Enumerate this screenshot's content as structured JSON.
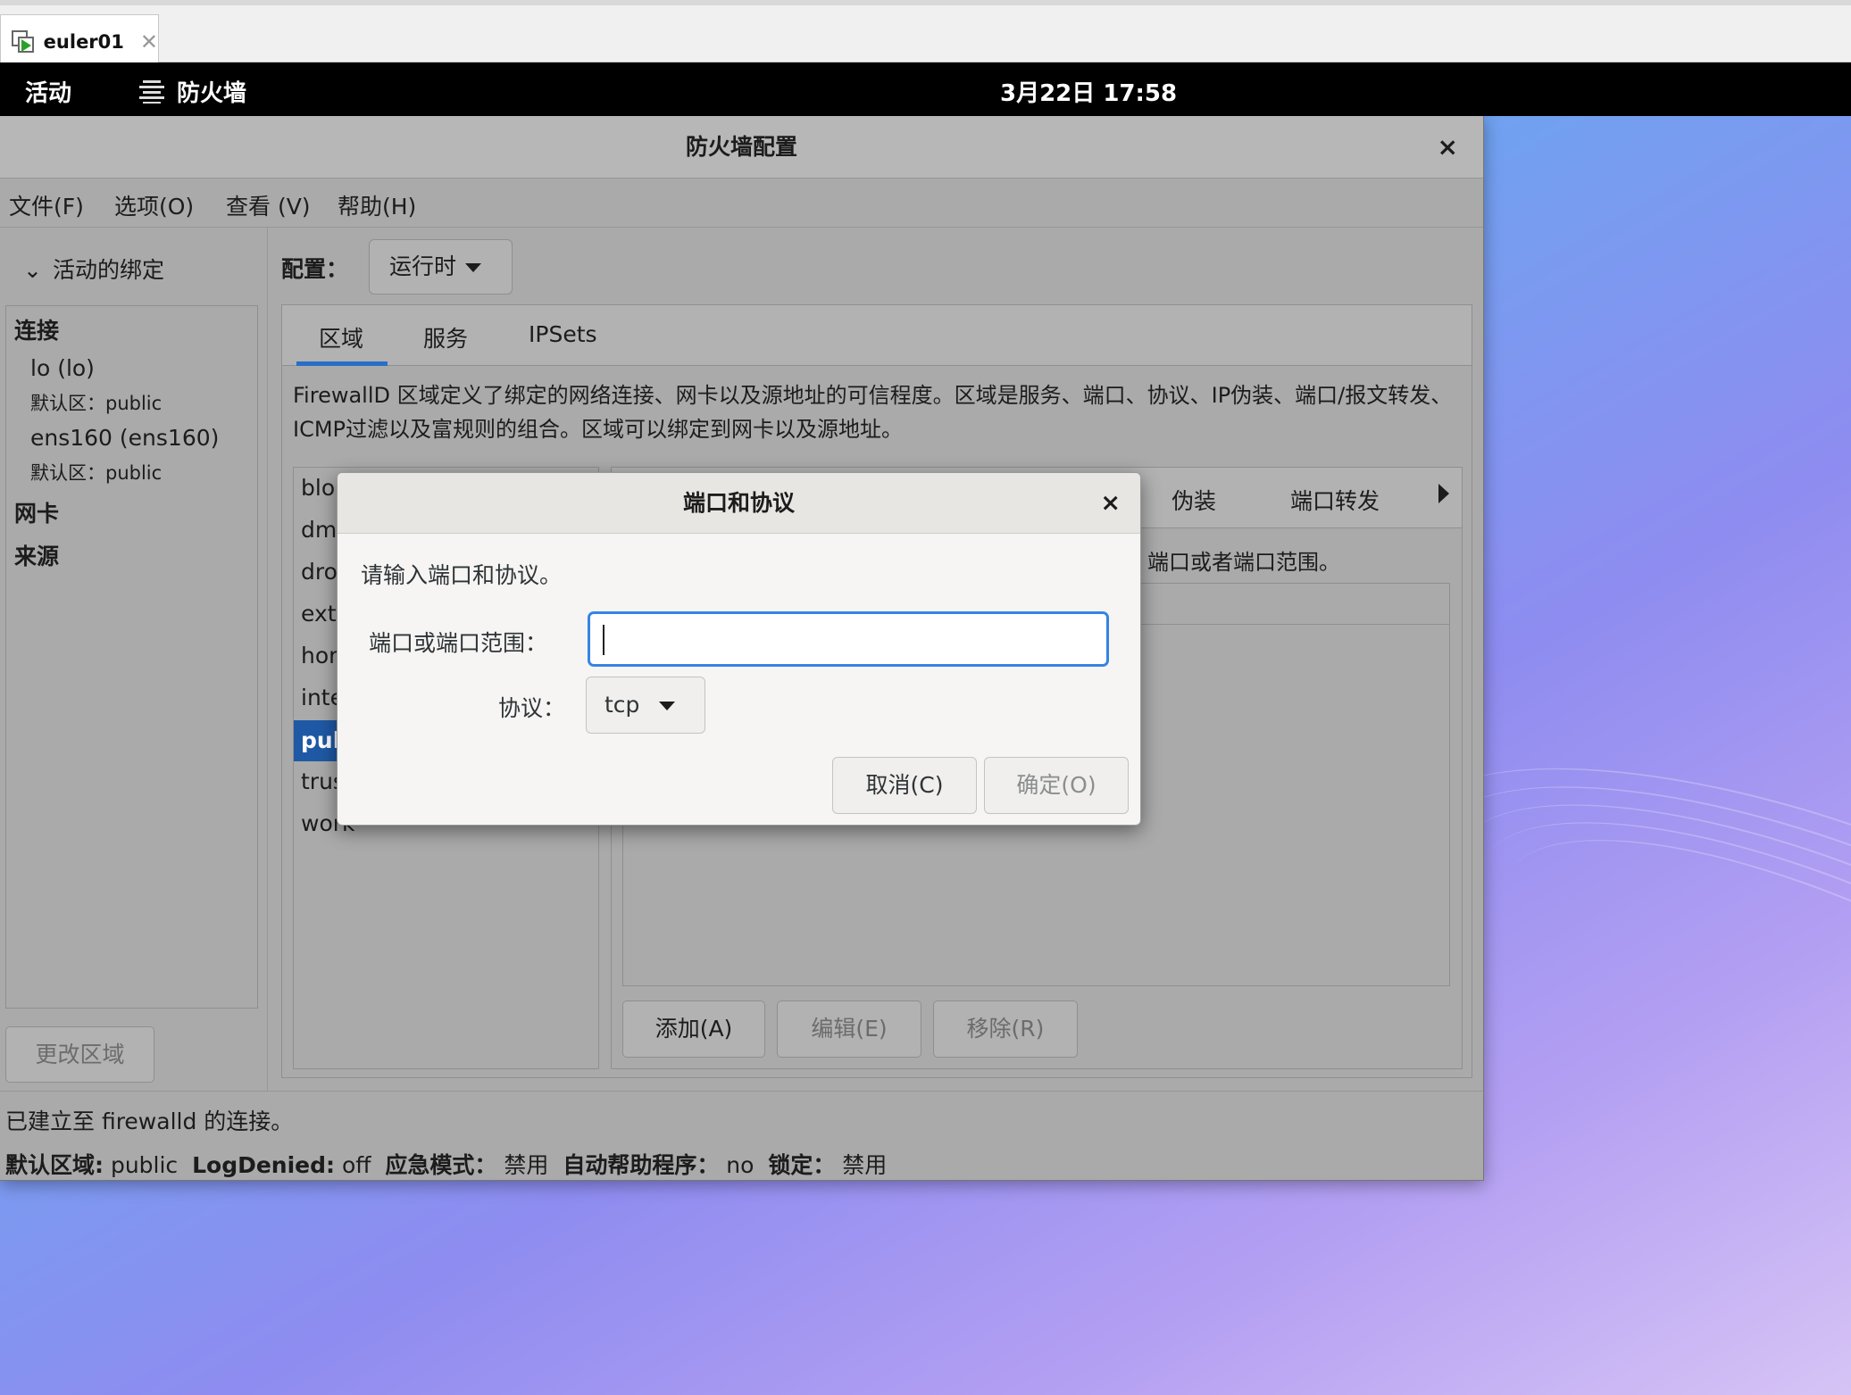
{
  "vm_tab": {
    "title": "euler01",
    "close": "✕"
  },
  "topbar": {
    "activities": "活动",
    "app_name": "防火墙",
    "clock": "3月22日 17:58"
  },
  "window": {
    "title": "防火墙配置",
    "close": "×",
    "menu": [
      "文件(F)",
      "选项(O)",
      "查看 (V)",
      "帮助(H)"
    ],
    "sidebar": {
      "header": "活动的绑定",
      "connections_heading": "连接",
      "connections": [
        {
          "name": "lo (lo)",
          "zone": "默认区：public"
        },
        {
          "name": "ens160 (ens160)",
          "zone": "默认区：public"
        }
      ],
      "interfaces_heading": "网卡",
      "sources_heading": "来源",
      "change_zone_button": "更改区域"
    },
    "config_label": "配置：",
    "config_value": "运行时",
    "tabs": [
      "区域",
      "服务",
      "IPSets"
    ],
    "description": "FirewallD 区域定义了绑定的网络连接、网卡以及源地址的可信程度。区域是服务、端口、协议、IP伪装、端口/报文转发、ICMP过滤以及富规则的组合。区域可以绑定到网卡以及源地址。",
    "zones": [
      "blo",
      "dm",
      "dro",
      "ext",
      "hor",
      "inte",
      "pul",
      "trus",
      "work"
    ],
    "selected_zone_index": 6,
    "inner_tabs_visible": [
      "伪装",
      "端口转发"
    ],
    "inner_hint": "端口或者端口范围。",
    "buttons": {
      "add": "添加(A)",
      "edit": "编辑(E)",
      "remove": "移除(R)"
    },
    "status": {
      "connection": "已建立至 firewalld 的连接。",
      "default_zone_label": "默认区域:",
      "default_zone_value": "public",
      "log_denied_label": "LogDenied:",
      "log_denied_value": "off",
      "panic_label": "应急模式：",
      "panic_value": "禁用",
      "helpers_label": "自动帮助程序：",
      "helpers_value": "no",
      "lockdown_label": "锁定：",
      "lockdown_value": "禁用"
    }
  },
  "dialog": {
    "title": "端口和协议",
    "close": "×",
    "prompt": "请输入端口和协议。",
    "port_label": "端口或端口范围：",
    "port_value": "",
    "protocol_label": "协议：",
    "protocol_value": "tcp",
    "cancel": "取消(C)",
    "ok": "确定(O)"
  },
  "colors": {
    "accent": "#3584e4",
    "selection": "#1f59a5",
    "topbar": "#000000"
  }
}
